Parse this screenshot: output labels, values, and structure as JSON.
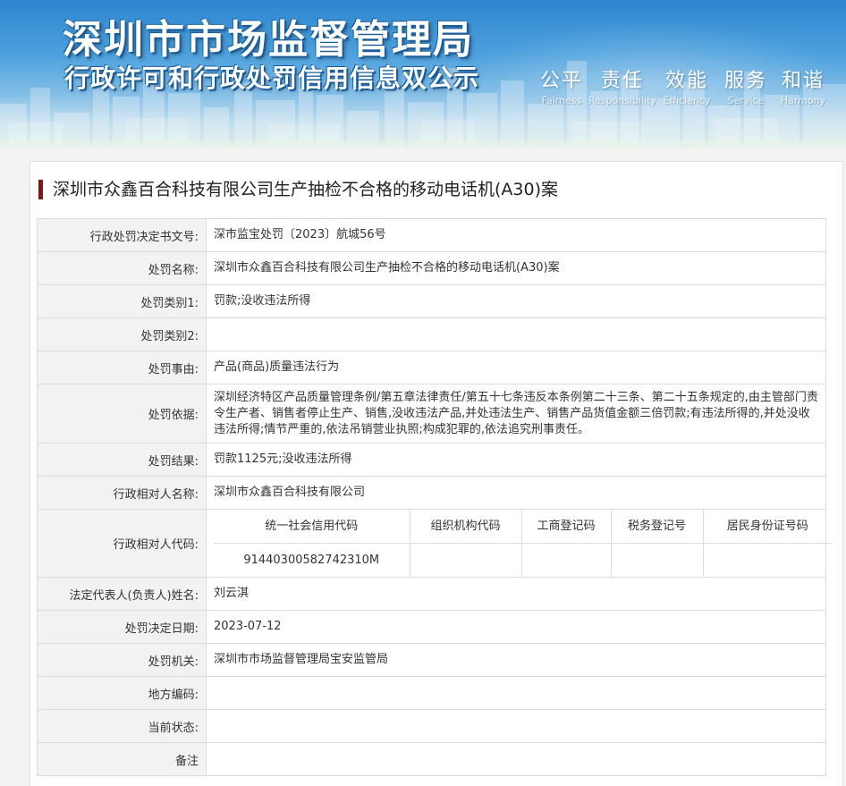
{
  "header": {
    "title": "深圳市市场监督管理局",
    "subtitle": "行政许可和行政处罚信用信息双公示",
    "slogans": [
      {
        "cn": "公平",
        "en": "Fairness"
      },
      {
        "cn": "责任",
        "en": "Responsibility"
      },
      {
        "cn": "效能",
        "en": "Efficiency"
      },
      {
        "cn": "服务",
        "en": "Service"
      },
      {
        "cn": "和谐",
        "en": "Harmony"
      }
    ]
  },
  "case": {
    "title": "深圳市众鑫百合科技有限公司生产抽检不合格的移动电话机(A30)案"
  },
  "fields": {
    "doc_no": {
      "label": "行政处罚决定书文号:",
      "value": "深市监宝处罚〔2023〕航城56号"
    },
    "penalty_name": {
      "label": "处罚名称:",
      "value": "深圳市众鑫百合科技有限公司生产抽检不合格的移动电话机(A30)案"
    },
    "category1": {
      "label": "处罚类别1:",
      "value": "罚款;没收违法所得"
    },
    "category2": {
      "label": "处罚类别2:",
      "value": ""
    },
    "reason": {
      "label": "处罚事由:",
      "value": "产品(商品)质量违法行为"
    },
    "basis": {
      "label": "处罚依据:",
      "value": "深圳经济特区产品质量管理条例/第五章法律责任/第五十七条违反本条例第二十三条、第二十五条规定的,由主管部门责令生产者、销售者停止生产、销售,没收违法产品,并处违法生产、销售产品货值金额三倍罚款;有违法所得的,并处没收违法所得;情节严重的,依法吊销营业执照;构成犯罪的,依法追究刑事责任。"
    },
    "result": {
      "label": "处罚结果:",
      "value": "罚款1125元;没收违法所得"
    },
    "party_name": {
      "label": "行政相对人名称:",
      "value": "深圳市众鑫百合科技有限公司"
    },
    "party_code": {
      "label": "行政相对人代码:",
      "headers": [
        "统一社会信用代码",
        "组织机构代码",
        "工商登记码",
        "税务登记号",
        "居民身份证号码"
      ],
      "values": [
        "91440300582742310M",
        "",
        "",
        "",
        ""
      ]
    },
    "legal_rep": {
      "label": "法定代表人(负责人)姓名:",
      "value": "刘云淇"
    },
    "decision_date": {
      "label": "处罚决定日期:",
      "value": "2023-07-12"
    },
    "authority": {
      "label": "处罚机关:",
      "value": "深圳市市场监督管理局宝安监管局"
    },
    "area_code": {
      "label": "地方编码:",
      "value": ""
    },
    "status": {
      "label": "当前状态:",
      "value": ""
    },
    "remark": {
      "label": "备注",
      "value": ""
    }
  },
  "colors": {
    "accent_bar": "#8a1414",
    "label_bg": "#f2f2f2",
    "border": "#dcdcdc",
    "banner_blue": "#2f86cf"
  }
}
